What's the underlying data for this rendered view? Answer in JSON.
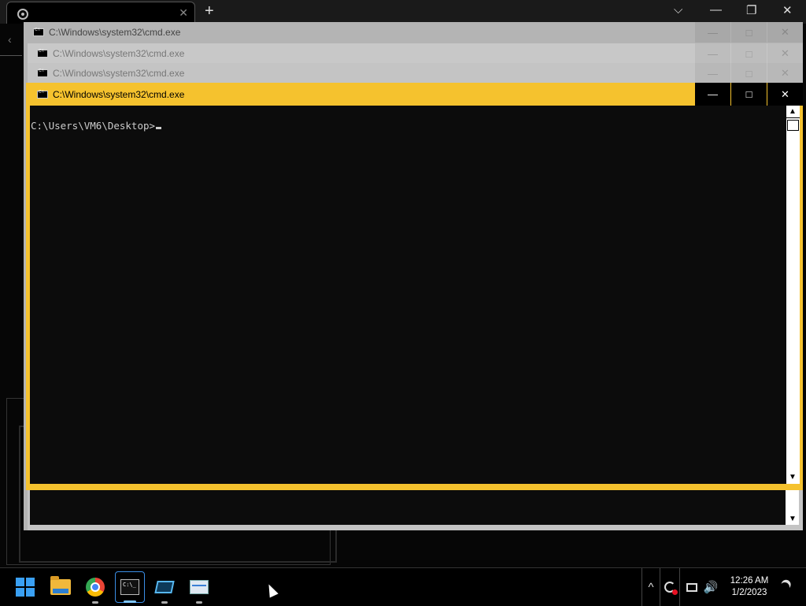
{
  "browser": {
    "tab_close": "✕",
    "new_tab": "+",
    "controls": {
      "dropdown": "⌵",
      "minimize": "—",
      "restore": "❐",
      "close": "✕"
    },
    "back_arrow": "‹"
  },
  "windows": [
    {
      "title": "C:\\Windows\\system32\\cmd.exe",
      "minimize": "—",
      "maximize": "□",
      "close": "✕"
    },
    {
      "title": "C:\\Windows\\system32\\cmd.exe",
      "minimize": "—",
      "maximize": "□",
      "close": "✕"
    },
    {
      "title": "C:\\Windows\\system32\\cmd.exe",
      "minimize": "—",
      "maximize": "□",
      "close": "✕"
    },
    {
      "title": "C:\\Windows\\system32\\cmd.exe",
      "minimize": "—",
      "maximize": "□",
      "close": "✕"
    }
  ],
  "console": {
    "prompt": "C:\\Users\\VM6\\Desktop>",
    "scroll_up": "▲",
    "scroll_down": "▼"
  },
  "back_scroll_down": "▼",
  "taskbar": {
    "apps": [
      {
        "name": "Start",
        "icon": "windows-logo-icon"
      },
      {
        "name": "File Explorer",
        "icon": "folder-icon"
      },
      {
        "name": "Google Chrome",
        "icon": "chrome-icon"
      },
      {
        "name": "Command Prompt",
        "icon": "terminal-icon",
        "active": true
      },
      {
        "name": "Remote Desktop",
        "icon": "rdp-icon"
      },
      {
        "name": "Performance Monitor",
        "icon": "perf-icon"
      }
    ],
    "tray": {
      "chevron": "^",
      "volume": "🔊",
      "time": "12:26 AM",
      "date": "1/2/2023"
    }
  },
  "colors": {
    "active_title": "#f5c22e",
    "inactive_title": "#c4c4c4",
    "console_bg": "#0c0c0c",
    "console_text": "#cccccc"
  }
}
